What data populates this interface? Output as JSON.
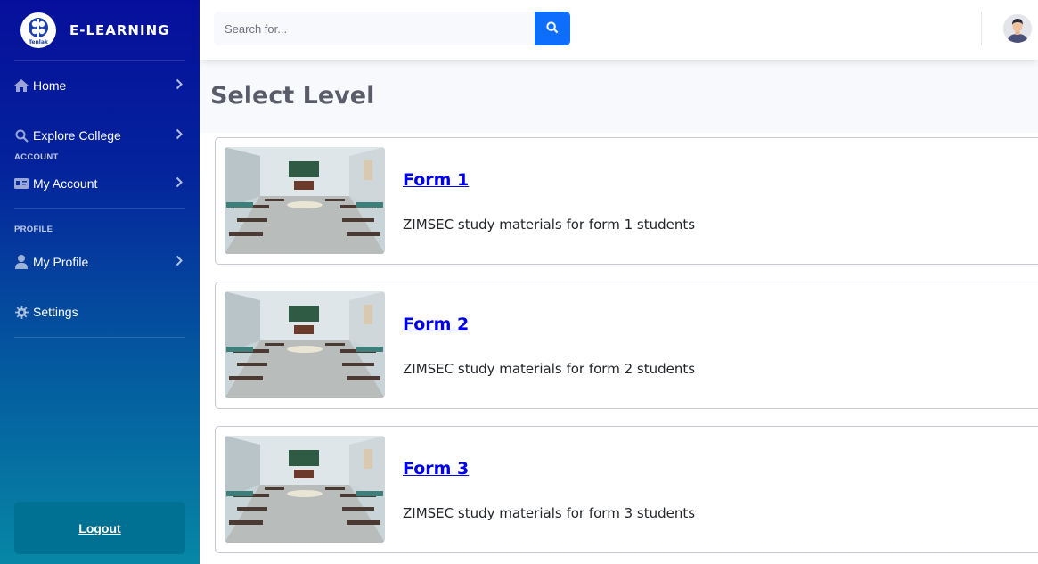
{
  "brand": {
    "name": "E-LEARNING",
    "logo_text": "Tenlak"
  },
  "sidebar": {
    "items": [
      {
        "label": "Home",
        "icon": "home-icon"
      },
      {
        "label": "Explore College",
        "icon": "search-icon"
      },
      {
        "label": "My Account",
        "icon": "id-card-icon"
      },
      {
        "label": "My Profile",
        "icon": "user-icon"
      },
      {
        "label": "Settings",
        "icon": "gear-icon"
      }
    ],
    "sections": {
      "account": "ACCOUNT",
      "profile": "PROFILE"
    },
    "logout": "Logout"
  },
  "topbar": {
    "search_placeholder": "Search for...",
    "search_button_icon": "search-icon",
    "avatar_icon": "user-avatar-icon"
  },
  "main": {
    "title": "Select Level",
    "cards": [
      {
        "title": "Form 1",
        "description": "ZIMSEC study materials for form 1 students",
        "image": "classroom-image"
      },
      {
        "title": "Form 2",
        "description": "ZIMSEC study materials for form 2 students",
        "image": "classroom-image"
      },
      {
        "title": "Form 3",
        "description": "ZIMSEC study materials for form 3 students",
        "image": "classroom-image"
      }
    ]
  },
  "colors": {
    "primary": "#0d6efd",
    "sidebar_top": "#060f9c",
    "sidebar_bottom": "#0787a5",
    "link": "#0000ee"
  }
}
